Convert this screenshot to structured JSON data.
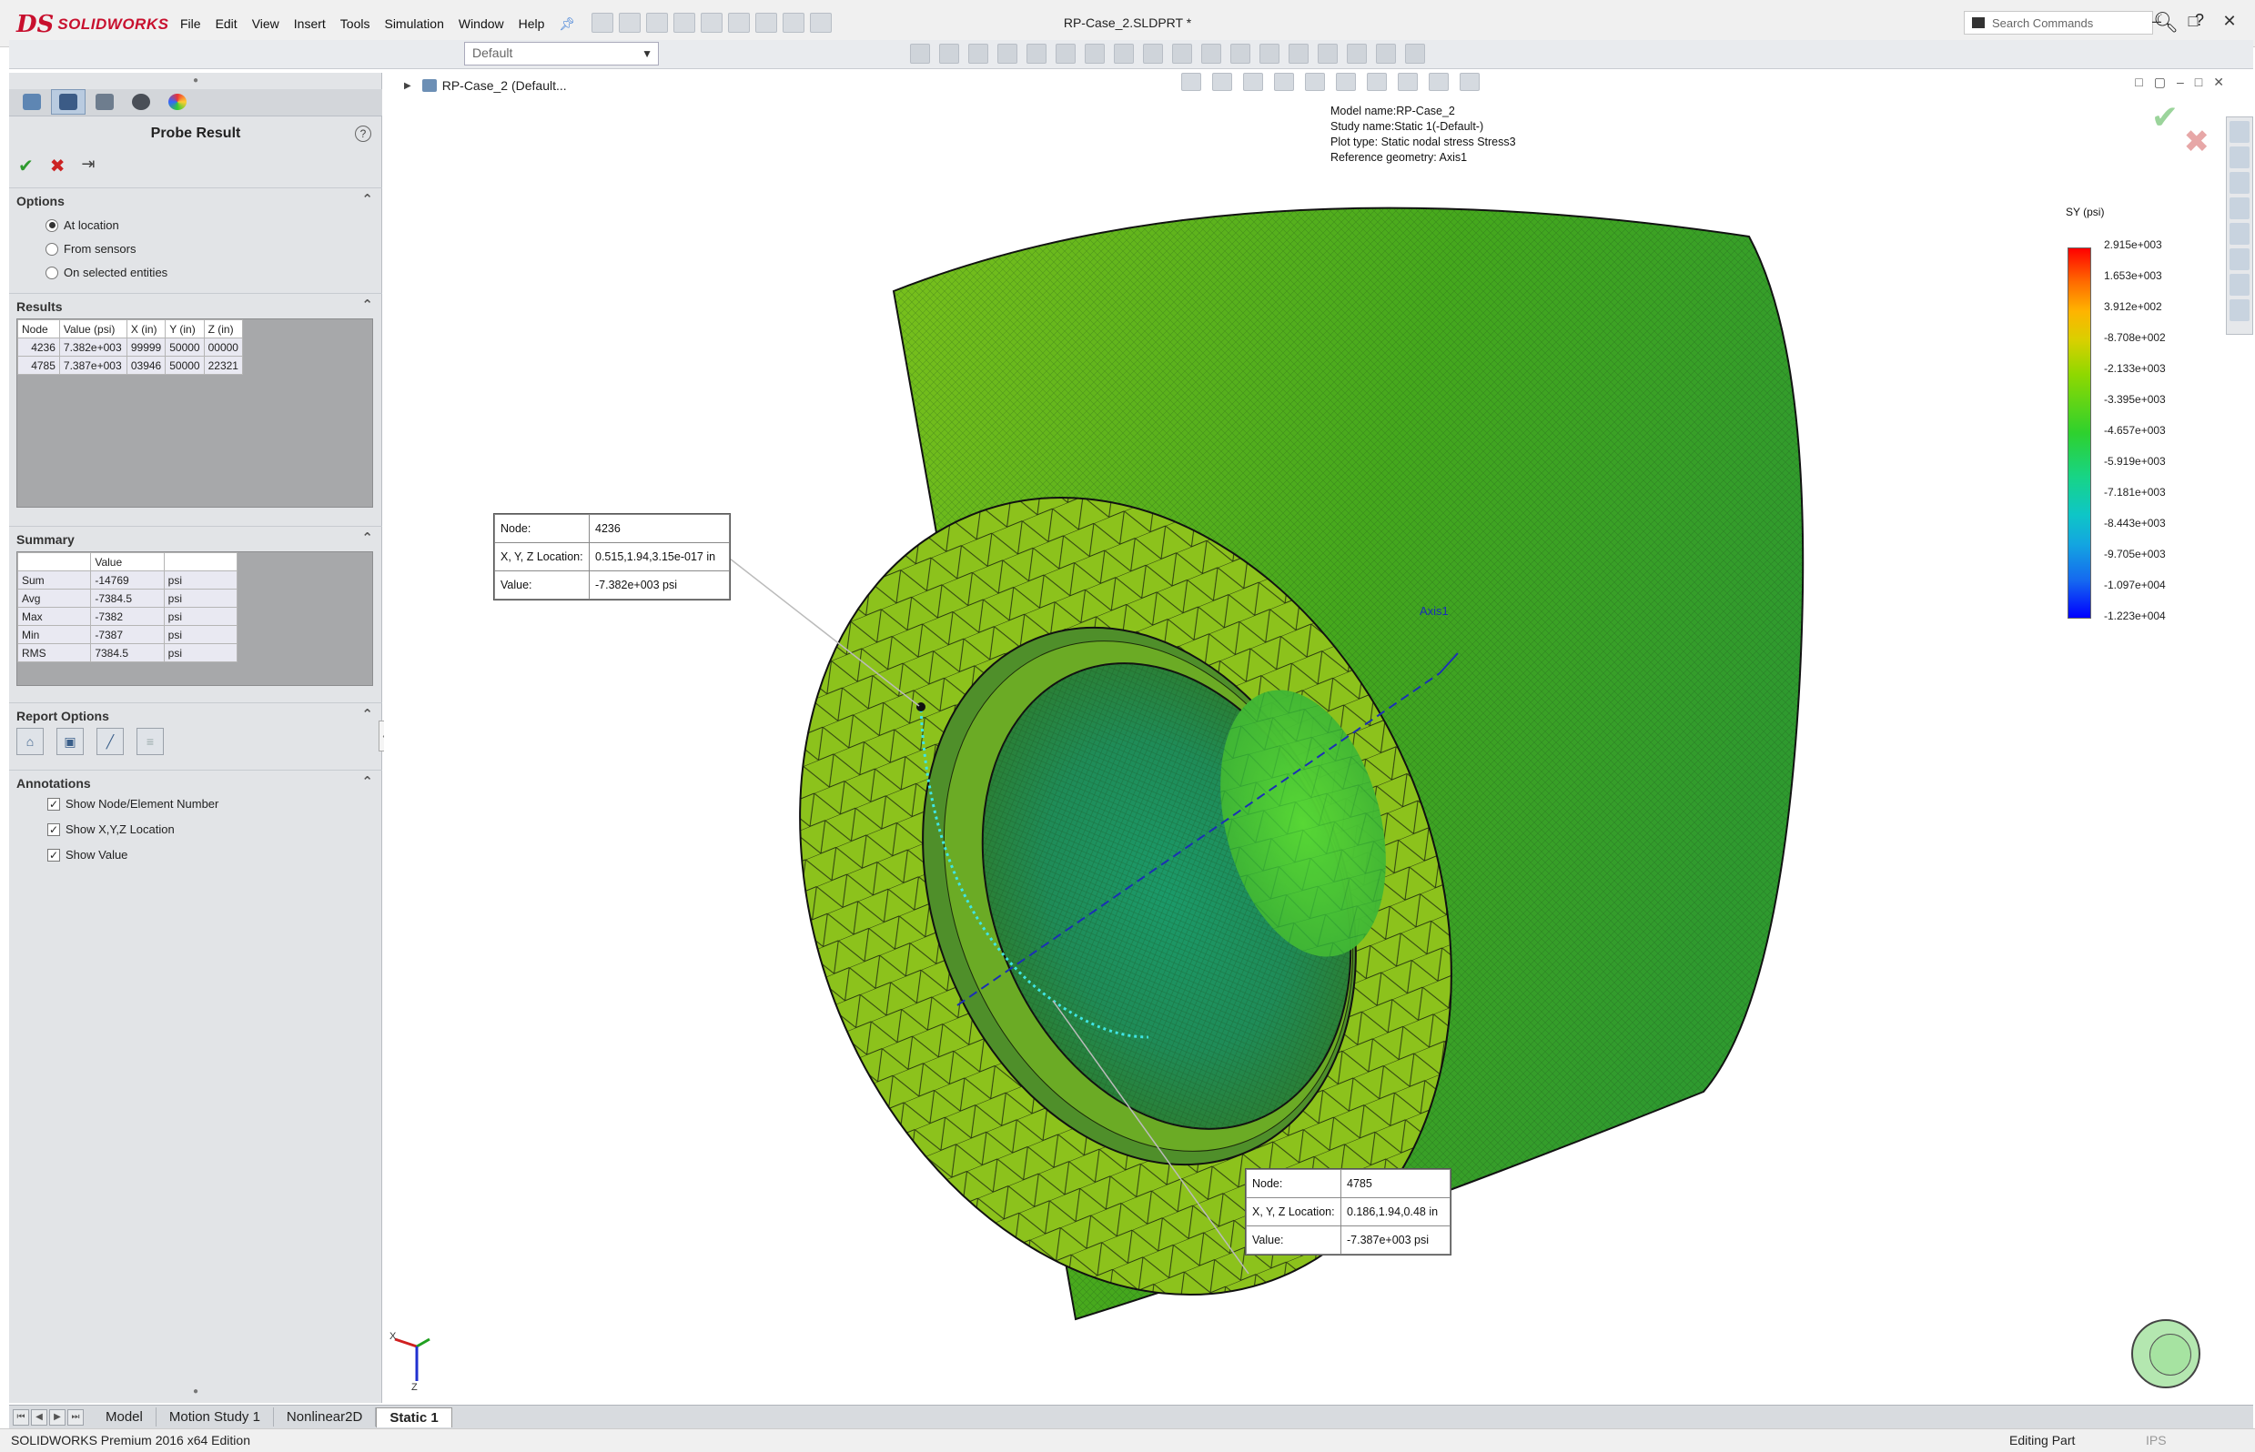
{
  "app": {
    "logo_ds": "DS",
    "logo_text": "SOLIDWORKS",
    "document_title": "RP-Case_2.SLDPRT *",
    "menu": [
      "File",
      "Edit",
      "View",
      "Insert",
      "Tools",
      "Simulation",
      "Window",
      "Help"
    ],
    "search_placeholder": "Search Commands",
    "configuration": "Default"
  },
  "property_manager": {
    "title": "Probe Result",
    "help": "?",
    "options": {
      "heading": "Options",
      "items": [
        {
          "label": "At location",
          "selected": true
        },
        {
          "label": "From sensors",
          "selected": false
        },
        {
          "label": "On selected entities",
          "selected": false
        }
      ]
    },
    "results": {
      "heading": "Results",
      "columns": [
        "Node",
        "Value (psi)",
        "X (in)",
        "Y (in)",
        "Z (in)"
      ],
      "rows": [
        [
          "4236",
          "7.382e+003",
          "99999",
          "50000",
          "00000"
        ],
        [
          "4785",
          "7.387e+003",
          "03946",
          "50000",
          "22321"
        ]
      ]
    },
    "summary": {
      "heading": "Summary",
      "columns": [
        "",
        "Value",
        ""
      ],
      "rows": [
        [
          "Sum",
          "-14769",
          "psi"
        ],
        [
          "Avg",
          "-7384.5",
          "psi"
        ],
        [
          "Max",
          "-7382",
          "psi"
        ],
        [
          "Min",
          "-7387",
          "psi"
        ],
        [
          "RMS",
          "7384.5",
          "psi"
        ]
      ]
    },
    "report_options": {
      "heading": "Report Options"
    },
    "annotations": {
      "heading": "Annotations",
      "items": [
        {
          "label": "Show Node/Element Number",
          "checked": true
        },
        {
          "label": "Show X,Y,Z Location",
          "checked": true
        },
        {
          "label": "Show Value",
          "checked": true
        }
      ]
    }
  },
  "viewport": {
    "tree_label": "RP-Case_2  (Default...",
    "info": {
      "model_name": "Model name:RP-Case_2",
      "study_name": "Study name:Static 1(-Default-)",
      "plot_type": "Plot type: Static nodal stress Stress3",
      "reference": "Reference geometry: Axis1"
    },
    "axis_label": "Axis1",
    "legend": {
      "title": "SY (psi)",
      "labels": [
        "2.915e+003",
        "1.653e+003",
        "3.912e+002",
        "-8.708e+002",
        "-2.133e+003",
        "-3.395e+003",
        "-4.657e+003",
        "-5.919e+003",
        "-7.181e+003",
        "-8.443e+003",
        "-9.705e+003",
        "-1.097e+004",
        "-1.223e+004"
      ]
    },
    "callout1": {
      "node_label": "Node:",
      "node": "4236",
      "xyz_label": "X, Y, Z Location:",
      "xyz": "0.515,1.94,3.15e-017 in",
      "value_label": "Value:",
      "value": "-7.382e+003 psi"
    },
    "callout2": {
      "node_label": "Node:",
      "node": "4785",
      "xyz_label": "X, Y, Z Location:",
      "xyz": "0.186,1.94,0.48 in",
      "value_label": "Value:",
      "value": "-7.387e+003 psi"
    }
  },
  "bottom_tabs": [
    "Model",
    "Motion Study 1",
    "Nonlinear2D",
    "Static 1"
  ],
  "status": {
    "edition": "SOLIDWORKS Premium 2016 x64 Edition",
    "mode": "Editing Part",
    "units": "IPS"
  },
  "colors": {
    "accent_red": "#c8102e",
    "mesh_green": "#7cc21a"
  }
}
